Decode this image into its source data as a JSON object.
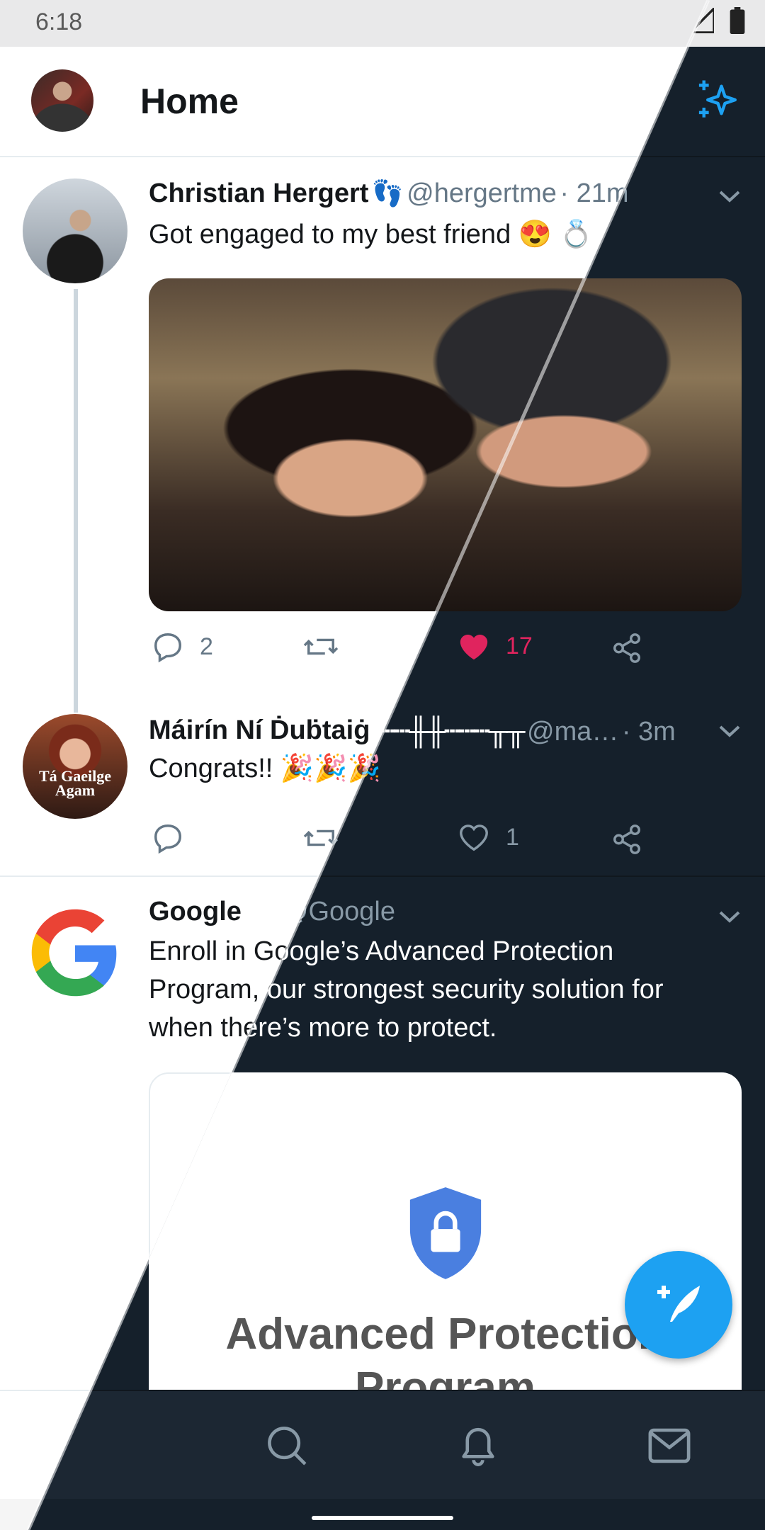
{
  "status_bar": {
    "time": "6:18"
  },
  "header": {
    "title": "Home"
  },
  "tweets": [
    {
      "name": "Christian Hergert",
      "name_emoji": "👣",
      "handle": "@hergertme",
      "time": "· 21m",
      "text": "Got engaged to my best friend 😍 💍",
      "replies": "2",
      "retweets": "",
      "likes": "17"
    },
    {
      "name": "Máirín Ní Ḋuḃtaiġ",
      "name_suffix": "/┄┄╫╫┄┄┄╥╥",
      "handle": "@ma…",
      "time": "· 3m",
      "text": "Congrats!! 🎉🎉🎉",
      "avatar_text": "Tá Gaeilge Agam",
      "replies": "",
      "retweets": "",
      "likes": "1"
    },
    {
      "name": "Google",
      "handle": "@Google",
      "text": "Enroll in Google’s Advanced Protection Program, our strongest security solution for when there’s more to protect.",
      "text_lines": [
        "Enroll in Google’s Advanced Protection",
        "Program, our strongest security solution for",
        "when there’s more to protect."
      ],
      "card_title_1": "Advanced Protection",
      "card_title_2": "Program"
    }
  ],
  "colors": {
    "accent": "#1da1f2",
    "like": "#e0245e",
    "dark_bg": "#15202b"
  },
  "icons": [
    "sparkle-icon",
    "reply-icon",
    "retweet-icon",
    "heart-icon",
    "share-icon",
    "chevron-down-icon",
    "verified-icon",
    "compose-icon",
    "home-icon",
    "search-icon",
    "bell-icon",
    "mail-icon"
  ]
}
